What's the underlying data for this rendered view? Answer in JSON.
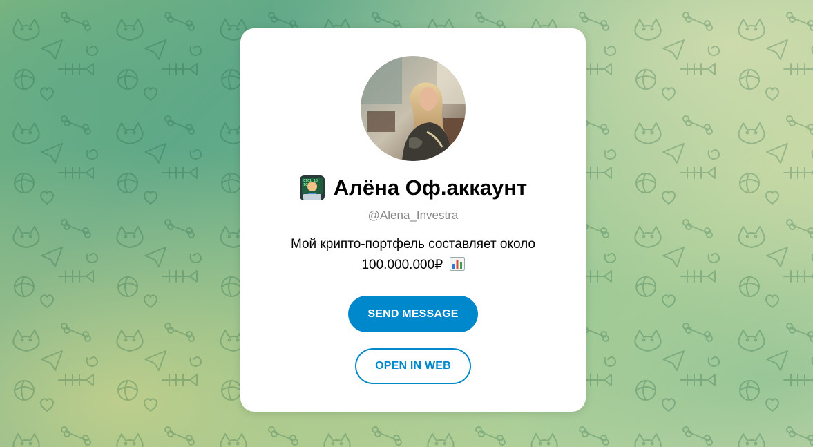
{
  "profile": {
    "display_name": "Алёна Оф.аккаунт",
    "name_emoji": "technologist-emoji",
    "username": "@Alena_Investra",
    "bio_line1": "Мой крипто-портфель составляет около",
    "bio_line2": "100.000.000₽",
    "bio_emoji": "bar-chart-emoji",
    "avatar": "profile-photo"
  },
  "actions": {
    "send_message_label": "SEND MESSAGE",
    "open_in_web_label": "OPEN IN WEB"
  },
  "colors": {
    "accent": "#0088cc",
    "card": "#ffffff",
    "username": "#868686"
  }
}
